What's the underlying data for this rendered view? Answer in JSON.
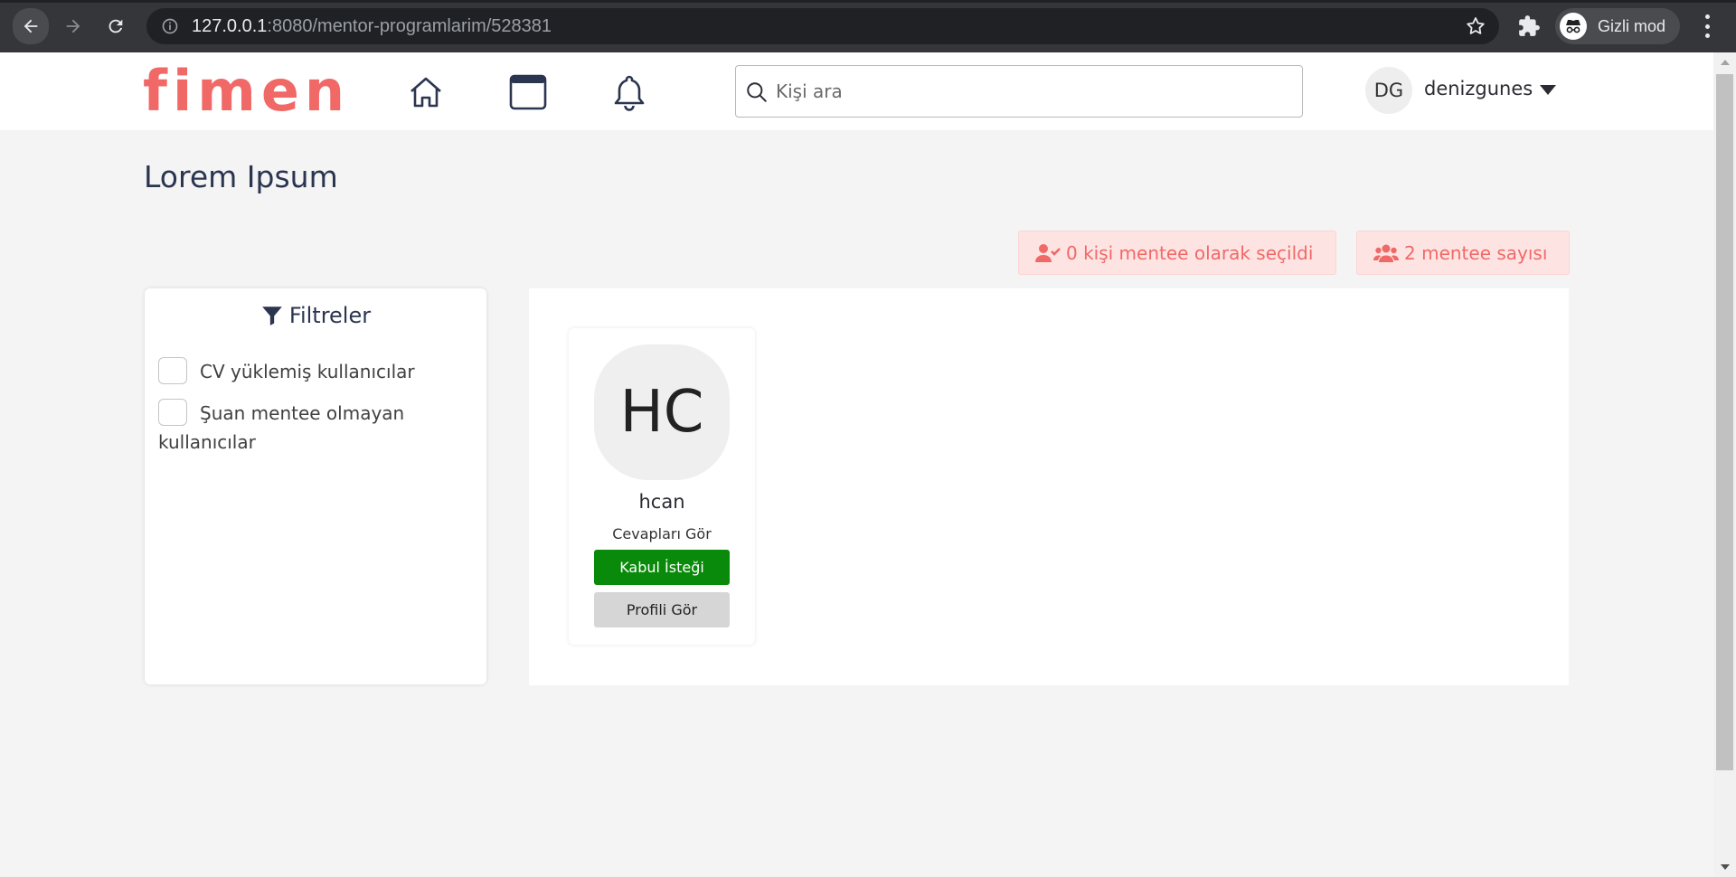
{
  "browser": {
    "url_host": "127.0.0.1",
    "url_path": ":8080/mentor-programlarim/528381",
    "incognito_label": "Gizli mod"
  },
  "header": {
    "logo": "fimen",
    "search_placeholder": "Kişi ara",
    "user_initials": "DG",
    "user_name": "denizgunes",
    "icons": [
      "home-icon",
      "window-icon",
      "bell-icon"
    ]
  },
  "page": {
    "title": "Lorem Ipsum"
  },
  "stats": {
    "selected_label": "0 kişi mentee olarak seçildi",
    "count_label": "2 mentee sayısı"
  },
  "filters": {
    "title": "Filtreler",
    "options": [
      {
        "label": "CV yüklemiş kullanıcılar",
        "checked": false
      },
      {
        "label": "Şuan mentee olmayan kullanıcılar",
        "checked": false
      }
    ]
  },
  "candidates": [
    {
      "initials": "HC",
      "username": "hcan",
      "answers_link": "Cevapları Gör",
      "accept_label": "Kabul İsteği",
      "profile_label": "Profili Gör"
    }
  ],
  "colors": {
    "brand": "#f06967",
    "accept": "#0a8a0a",
    "pill_bg": "#fde4e3"
  }
}
